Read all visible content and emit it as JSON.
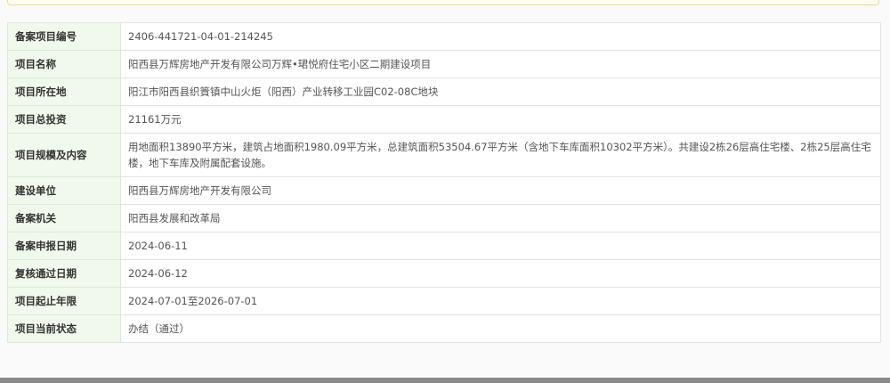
{
  "rows": [
    {
      "label": "备案项目编号",
      "value": "2406-441721-04-01-214245"
    },
    {
      "label": "项目名称",
      "value": "阳西县万辉房地产开发有限公司万辉•珺悦府住宅小区二期建设项目"
    },
    {
      "label": "项目所在地",
      "value": "阳江市阳西县织篢镇中山火炬（阳西）产业转移工业园C02-08C地块"
    },
    {
      "label": "项目总投资",
      "value": "21161万元"
    },
    {
      "label": "项目规模及内容",
      "value": "用地面积13890平方米，建筑占地面积1980.09平方米，总建筑面积53504.67平方米（含地下车库面积10302平方米）。共建设2栋26层高住宅楼、2栋25层高住宅楼，地下车库及附属配套设施。"
    },
    {
      "label": "建设单位",
      "value": "阳西县万辉房地产开发有限公司"
    },
    {
      "label": "备案机关",
      "value": "阳西县发展和改革局"
    },
    {
      "label": "备案申报日期",
      "value": "2024-06-11"
    },
    {
      "label": "复核通过日期",
      "value": "2024-06-12"
    },
    {
      "label": "项目起止年限",
      "value": "2024-07-01至2026-07-01"
    },
    {
      "label": "项目当前状态",
      "value": "办结（通过）"
    }
  ]
}
